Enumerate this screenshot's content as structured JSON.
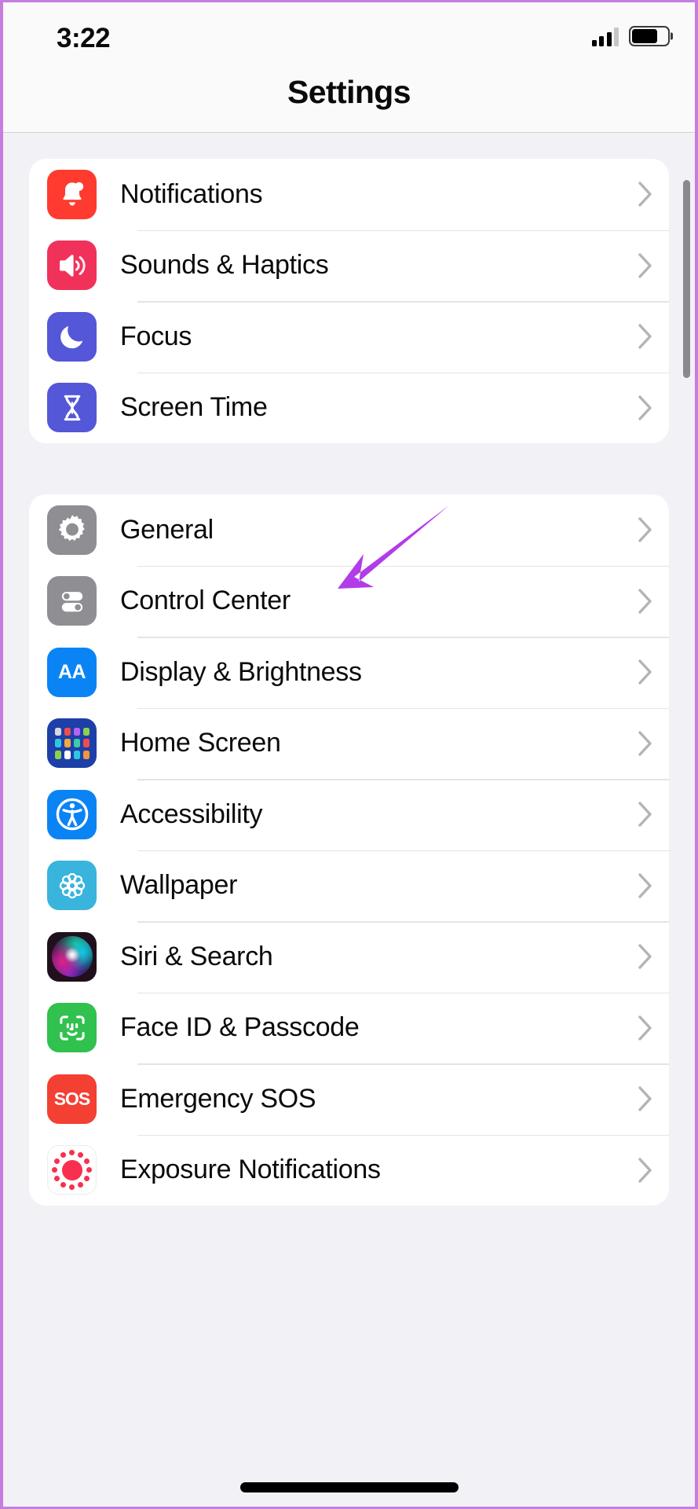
{
  "status_bar": {
    "time": "3:22",
    "signal_icon": "cellular-signal-icon",
    "signal_bars_filled": 3,
    "signal_bars_total": 4,
    "battery_icon": "battery-icon",
    "battery_level_percent": 72
  },
  "header": {
    "title": "Settings"
  },
  "colors": {
    "frame_border": "#c77ce0",
    "page_background": "#f2f1f6",
    "card_background": "#ffffff",
    "header_background": "#fafafa",
    "divider": "#e4e4e6",
    "chevron": "#b4b4b8",
    "annotation_arrow": "#b23ce8",
    "scrollbar": "#8a8a8e",
    "home_indicator": "#000000"
  },
  "annotation": {
    "type": "arrow",
    "color": "#b23ce8",
    "points_to": "Control Center"
  },
  "groups": [
    {
      "name": "notifications-group",
      "rows": [
        {
          "label": "Notifications",
          "icon": "bell-icon",
          "icon_color": "#ff3b30",
          "chevron": "chevron-right-icon"
        },
        {
          "label": "Sounds & Haptics",
          "icon": "speaker-waves-icon",
          "icon_color": "#f0325b",
          "chevron": "chevron-right-icon"
        },
        {
          "label": "Focus",
          "icon": "moon-icon",
          "icon_color": "#5457d8",
          "chevron": "chevron-right-icon"
        },
        {
          "label": "Screen Time",
          "icon": "hourglass-icon",
          "icon_color": "#5457d8",
          "chevron": "chevron-right-icon"
        }
      ]
    },
    {
      "name": "system-group",
      "rows": [
        {
          "label": "General",
          "icon": "gear-icon",
          "icon_color": "#8e8e93",
          "chevron": "chevron-right-icon"
        },
        {
          "label": "Control Center",
          "icon": "toggles-icon",
          "icon_color": "#8e8e93",
          "chevron": "chevron-right-icon"
        },
        {
          "label": "Display & Brightness",
          "icon": "text-size-aa-icon",
          "icon_color": "#0a84f5",
          "chevron": "chevron-right-icon"
        },
        {
          "label": "Home Screen",
          "icon": "app-grid-icon",
          "icon_color": "#1c3fa8",
          "chevron": "chevron-right-icon"
        },
        {
          "label": "Accessibility",
          "icon": "accessibility-icon",
          "icon_color": "#0a84f5",
          "chevron": "chevron-right-icon"
        },
        {
          "label": "Wallpaper",
          "icon": "flower-icon",
          "icon_color": "#38b4dd",
          "chevron": "chevron-right-icon"
        },
        {
          "label": "Siri & Search",
          "icon": "siri-orb-icon",
          "icon_color": "#2a1030",
          "chevron": "chevron-right-icon"
        },
        {
          "label": "Face ID & Passcode",
          "icon": "face-id-icon",
          "icon_color": "#30c14e",
          "chevron": "chevron-right-icon"
        },
        {
          "label": "Emergency SOS",
          "icon": "sos-icon",
          "icon_color": "#f43f33",
          "chevron": "chevron-right-icon"
        },
        {
          "label": "Exposure Notifications",
          "icon": "exposure-dots-icon",
          "icon_color": "#ffffff",
          "chevron": "chevron-right-icon"
        }
      ]
    }
  ]
}
